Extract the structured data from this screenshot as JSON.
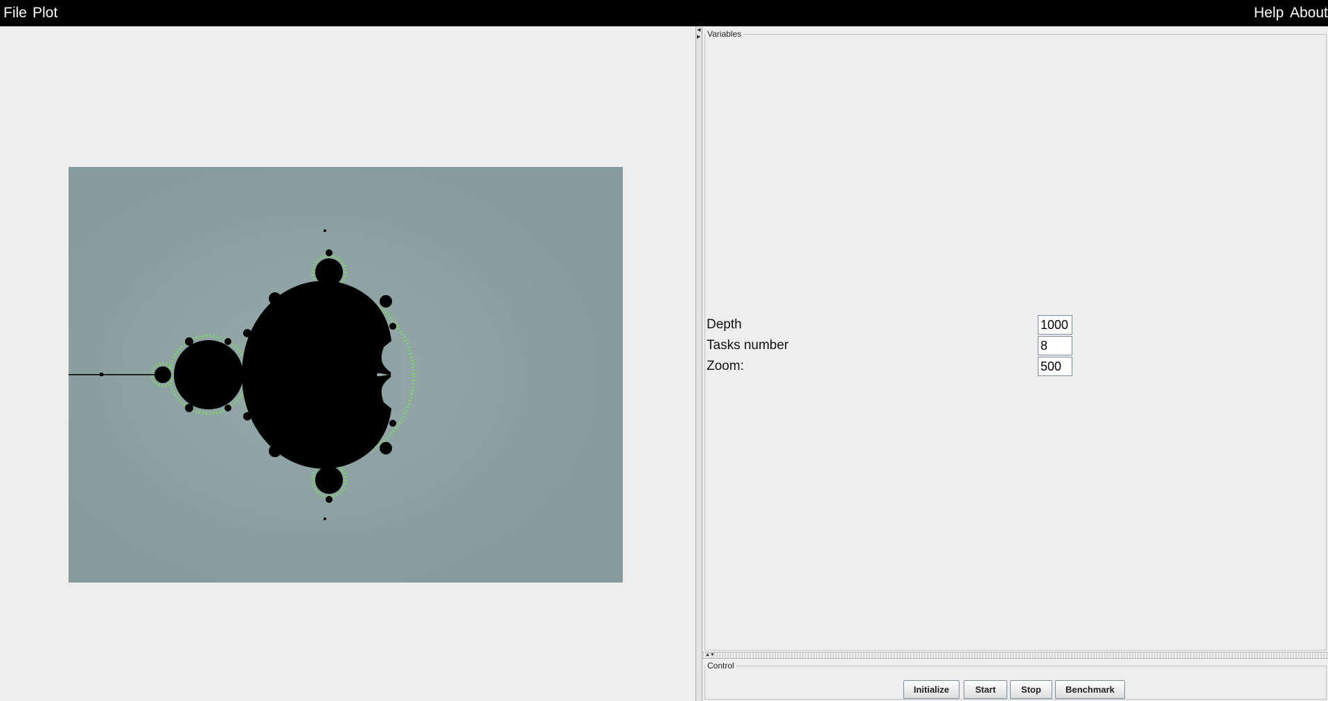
{
  "menubar": {
    "left_items": [
      "File",
      "Plot"
    ],
    "right_items": [
      "Help",
      "About"
    ]
  },
  "variables": {
    "title": "Variables",
    "fields": [
      {
        "label": "Depth",
        "value": "1000"
      },
      {
        "label": "Tasks number",
        "value": "8"
      },
      {
        "label": "Zoom:",
        "value": "500"
      }
    ]
  },
  "control": {
    "title": "Control",
    "buttons": [
      "Initialize",
      "Start",
      "Stop",
      "Benchmark"
    ]
  },
  "colors": {
    "menubar_bg": "#000000",
    "fractal_bg": "#8aa09e",
    "fractal_set": "#000000",
    "fractal_edge": "#7fd66a"
  }
}
